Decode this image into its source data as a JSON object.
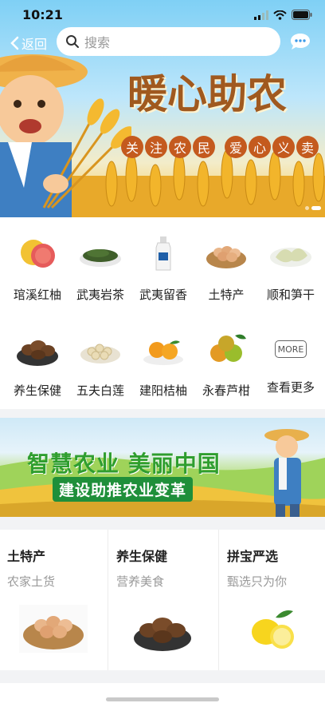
{
  "status_bar": {
    "time": "10:21"
  },
  "topbar": {
    "back_label": "返回",
    "search_placeholder": "搜索"
  },
  "hero": {
    "title": "暖心助农",
    "tagline_left": [
      "关",
      "注",
      "农",
      "民"
    ],
    "tagline_right": [
      "爱",
      "心",
      "义",
      "卖"
    ]
  },
  "categories": [
    {
      "label": "琯溪红柚",
      "icon": "pomelo-icon"
    },
    {
      "label": "武夷岩茶",
      "icon": "tea-leaves-icon"
    },
    {
      "label": "武夷留香",
      "icon": "liquor-bottle-icon"
    },
    {
      "label": "土特产",
      "icon": "egg-basket-icon"
    },
    {
      "label": "顺和笋干",
      "icon": "bamboo-shoot-icon"
    },
    {
      "label": "养生保健",
      "icon": "mushroom-bowl-icon"
    },
    {
      "label": "五夫白莲",
      "icon": "lotus-seed-icon"
    },
    {
      "label": "建阳桔柚",
      "icon": "tangerine-icon"
    },
    {
      "label": "永春芦柑",
      "icon": "ponkan-icon"
    },
    {
      "label": "查看更多",
      "icon": "more-icon",
      "badge": "MORE"
    }
  ],
  "banner2": {
    "line1": "智慧农业 美丽中国",
    "line2": "建设助推农业变革"
  },
  "cards": [
    {
      "title": "土特产",
      "subtitle": "农家土货",
      "image": "egg-basket-icon"
    },
    {
      "title": "养生保健",
      "subtitle": "营养美食",
      "image": "mushroom-bowl-icon"
    },
    {
      "title": "拼宝严选",
      "subtitle": "甄选只为你",
      "image": "lemon-icon"
    }
  ],
  "colors": {
    "accent": "#c45a1e",
    "title_brown": "#a0591f",
    "banner_green": "#2f9e2f"
  }
}
